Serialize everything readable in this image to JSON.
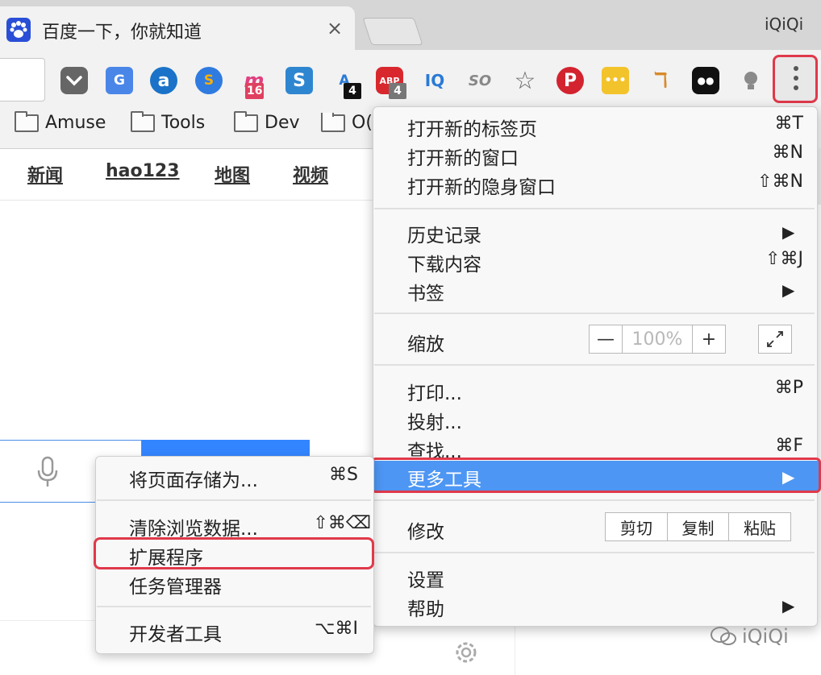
{
  "tab": {
    "title": "百度一下，你就知道",
    "close": "×"
  },
  "profile": "iQiQi",
  "extensions": [
    {
      "name": "pocket-icon"
    },
    {
      "name": "google-translate-icon",
      "glyph": "G"
    },
    {
      "name": "at-icon",
      "glyph": "a"
    },
    {
      "name": "sogou-icon",
      "glyph": "S"
    },
    {
      "name": "m-icon",
      "glyph": "m",
      "badge": "16"
    },
    {
      "name": "s-icon",
      "glyph": "S"
    },
    {
      "name": "shield-a-icon",
      "glyph": "A",
      "badge": "4"
    },
    {
      "name": "adblock-icon",
      "glyph": "ABP",
      "badge": "4"
    },
    {
      "name": "iq-icon",
      "glyph": "IQ"
    },
    {
      "name": "so-icon",
      "glyph": "SO"
    },
    {
      "name": "star-icon",
      "glyph": "☆"
    },
    {
      "name": "pinterest-icon",
      "glyph": "P"
    },
    {
      "name": "dots-icon",
      "glyph": "•••"
    },
    {
      "name": "tool-icon",
      "glyph": "ℸ"
    },
    {
      "name": "glasses-icon",
      "glyph": "●●"
    },
    {
      "name": "bulb-icon",
      "glyph": "✳"
    }
  ],
  "bookmarks": [
    "Amuse",
    "Tools",
    "Dev",
    "O("
  ],
  "page_nav": [
    "新闻",
    "hao123",
    "地图",
    "视频"
  ],
  "menu": {
    "new_tab": "打开新的标签页",
    "new_tab_sc": "⌘T",
    "new_window": "打开新的窗口",
    "new_window_sc": "⌘N",
    "incognito": "打开新的隐身窗口",
    "incognito_sc": "⇧⌘N",
    "history": "历史记录",
    "history_arrow": "▶",
    "downloads": "下载内容",
    "downloads_sc": "⇧⌘J",
    "bookmarks": "书签",
    "bookmarks_arrow": "▶",
    "zoom": "缩放",
    "zoom_minus": "—",
    "zoom_value": "100%",
    "zoom_plus": "+",
    "print": "打印...",
    "print_sc": "⌘P",
    "cast": "投射...",
    "find": "查找...",
    "find_sc": "⌘F",
    "more_tools": "更多工具",
    "more_tools_arrow": "▶",
    "edit": "修改",
    "cut": "剪切",
    "copy": "复制",
    "paste": "粘贴",
    "settings": "设置",
    "help": "帮助",
    "help_arrow": "▶"
  },
  "submenu": {
    "save_page": "将页面存储为...",
    "save_page_sc": "⌘S",
    "clear_data": "清除浏览数据...",
    "clear_data_sc": "⇧⌘⌫",
    "extensions": "扩展程序",
    "task_manager": "任务管理器",
    "dev_tools": "开发者工具",
    "dev_tools_sc": "⌥⌘I"
  },
  "watermark": "iQiQi",
  "colors": {
    "highlight": "#4d96f3",
    "callout": "#e0394a",
    "baidu_blue": "#3385ff"
  }
}
